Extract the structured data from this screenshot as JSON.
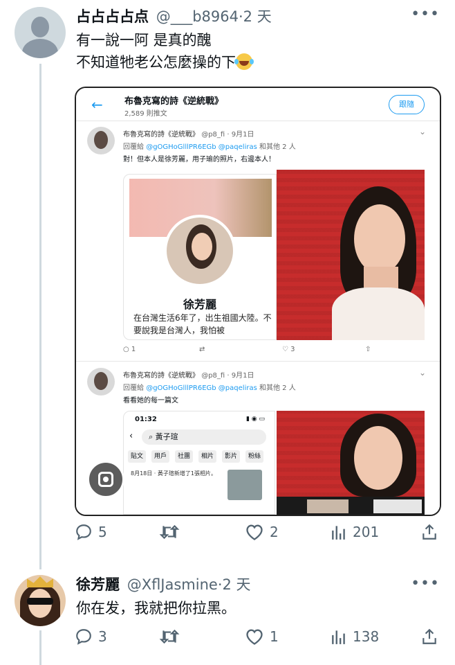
{
  "tweet1": {
    "name": "占占占占点",
    "handle": "@___b8964",
    "time": "2 天",
    "lines": [
      "有一說一阿 是真的醜",
      "不知道牠老公怎麼操的下"
    ],
    "emoji": "face-with-tears-of-joy",
    "actions": {
      "replies": "5",
      "likes": "2",
      "views": "201"
    }
  },
  "tweet2": {
    "name": "徐芳麗",
    "handle": "@XflJasmine",
    "time": "2 天",
    "text": "你在发，我就把你拉黑。",
    "actions": {
      "replies": "3",
      "likes": "1",
      "views": "138"
    }
  },
  "more_label": "•••",
  "sep": "·",
  "embedded": {
    "account_title": "布魯克寫的詩《逆統戰》",
    "post_count": "2,589 則推文",
    "follow_label": "跟隨",
    "post1": {
      "name": "布魯克寫的詩《逆統戰》",
      "handle": "@p8_fi · 9月1日",
      "reply_prefix": "回覆給",
      "reply_mentions": "@gOGHoGlllPR6EGb @paqeliras",
      "reply_suffix": "和其他 2 人",
      "text": "對！但本人是徐芳麗，用子瑜的照片，右邊本人！",
      "card_name": "徐芳麗",
      "card_bio": "在台灣生活6年了，出生祖國大陸。不要說我是台灣人，我怕被",
      "reply_count": "1",
      "like_count": "3"
    },
    "post2": {
      "name": "布魯克寫的詩《逆統戰》",
      "handle": "@p8_fi · 9月1日",
      "reply_prefix": "回覆給",
      "reply_mentions": "@gOGHoGlllPR6EGb @paqeliras",
      "reply_suffix": "和其他 2 人",
      "text": "看看她的每一篇文",
      "phone_time": "01:32",
      "phone_search": "黃子瑄",
      "phone_tabs": [
        "貼文",
        "用戶",
        "社團",
        "相片",
        "影片",
        "粉絲"
      ],
      "phone_post": "8月18日 · 黃子瑄新增了1張相片。"
    }
  }
}
